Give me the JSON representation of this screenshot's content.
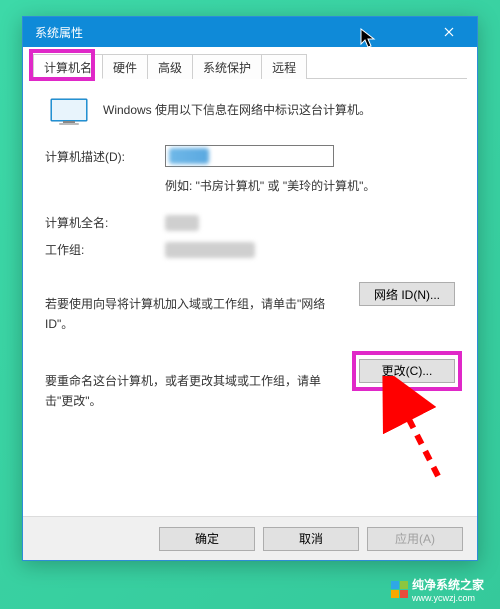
{
  "window": {
    "title": "系统属性",
    "close_icon": "close"
  },
  "tabs": {
    "computer_name": "计算机名",
    "hardware": "硬件",
    "advanced": "高级",
    "system_protection": "系统保护",
    "remote": "远程"
  },
  "content": {
    "intro": "Windows 使用以下信息在网络中标识这台计算机。",
    "desc_label": "计算机描述(D):",
    "desc_value": "",
    "example": "例如: \"书房计算机\" 或 \"美玲的计算机\"。",
    "full_name_label": "计算机全名:",
    "full_name_value": "",
    "workgroup_label": "工作组:",
    "workgroup_value": "",
    "join_domain_text": "若要使用向导将计算机加入域或工作组，请单击\"网络 ID\"。",
    "network_id_btn": "网络 ID(N)...",
    "rename_text": "要重命名这台计算机，或者更改其域或工作组，请单击\"更改\"。",
    "change_btn": "更改(C)..."
  },
  "buttons": {
    "ok": "确定",
    "cancel": "取消",
    "apply": "应用(A)"
  },
  "watermark": {
    "text": "纯净系统之家",
    "url": "www.ycwzj.com"
  }
}
